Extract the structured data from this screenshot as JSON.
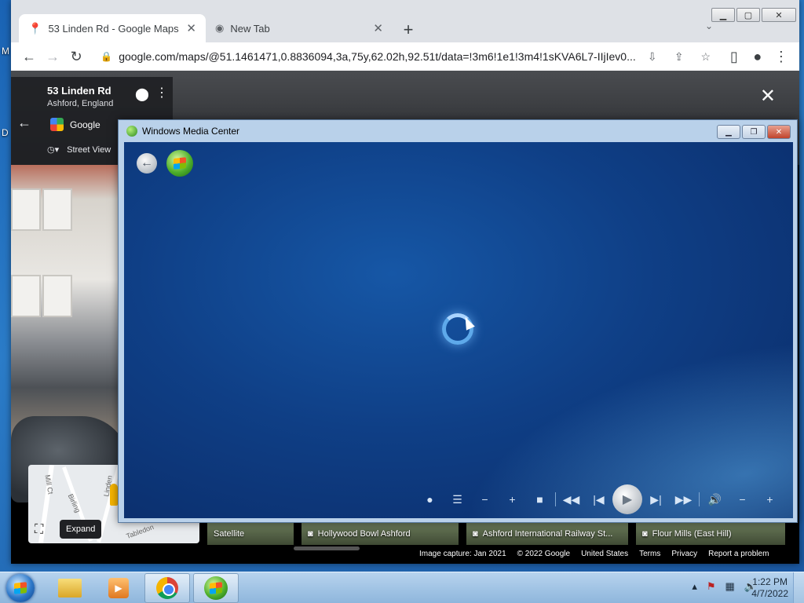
{
  "desktop": {
    "frag_top": "M",
    "frag_mid": "D"
  },
  "chrome": {
    "tabs": [
      {
        "title": "53 Linden Rd - Google Maps",
        "icon": "maps-pin-icon"
      },
      {
        "title": "New Tab",
        "icon": "chrome-icon"
      }
    ],
    "url": "google.com/maps/@51.1461471,0.8836094,3a,75y,62.02h,92.51t/data=!3m6!1e1!3m4!1sKVA6L7-IIjIev0..."
  },
  "streetview": {
    "title": "53 Linden Rd",
    "subtitle": "Ashford, England",
    "provider": "Google",
    "mode_label": "Street View",
    "expand_label": "Expand",
    "map_labels": [
      "Mill Ct",
      "Birling",
      "Linden",
      "Tabledon"
    ],
    "thumbnails": [
      "Satellite",
      "Hollywood Bowl Ashford",
      "Ashford International Railway St...",
      "Flour Mills (East Hill)"
    ],
    "attribution": [
      "Image capture: Jan 2021",
      "© 2022 Google",
      "United States",
      "Terms",
      "Privacy",
      "Report a problem"
    ]
  },
  "wmc": {
    "title": "Windows Media Center"
  },
  "taskbar": {
    "time": "1:22 PM",
    "date": "4/7/2022"
  }
}
